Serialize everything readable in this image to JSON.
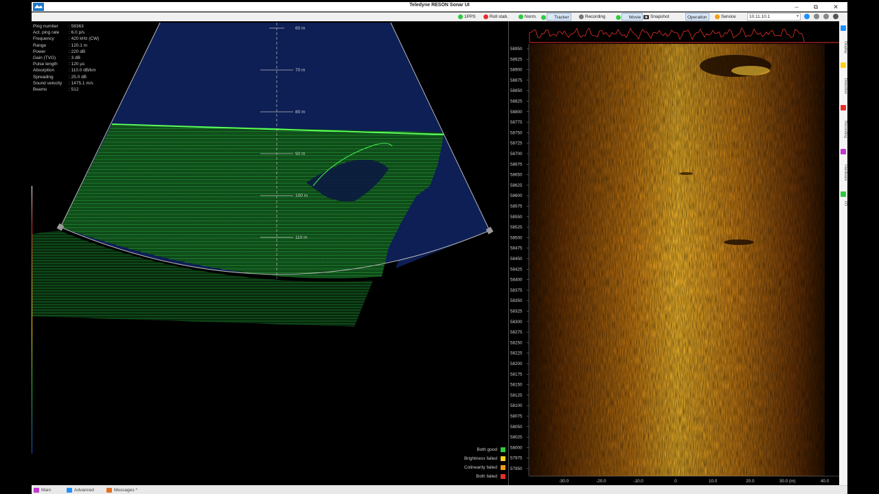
{
  "window": {
    "title": "Teledyne RESON Sonar UI",
    "colors": {
      "accent": "#1e90ff",
      "ok": "#2ecc40",
      "warn": "#ffd21f",
      "err": "#e8302a"
    }
  },
  "toolbar": {
    "items": [
      {
        "label": "1PPS",
        "status": "green"
      },
      {
        "label": "Roll stab.",
        "status": "red"
      },
      {
        "label": "Norm.",
        "status": "green"
      },
      {
        "label": "Tracker",
        "status": "green",
        "active": true
      },
      {
        "label": "Recording",
        "status": "gray"
      },
      {
        "label": "Movie",
        "status": "green",
        "active": true
      },
      {
        "label": "Snapshot",
        "status": "camera"
      },
      {
        "label": "Operation",
        "status": "none",
        "active": true
      },
      {
        "label": "Service",
        "status": "orange"
      }
    ],
    "ip_address": "10.11.10.1"
  },
  "sonar_info": {
    "rows": [
      {
        "key": "Ping number",
        "value": ": 58363"
      },
      {
        "key": "Act. ping rate",
        "value": ": 6.0 p/s"
      },
      {
        "key": "Frequency",
        "value": ": 420 kHz (CW)"
      },
      {
        "key": "Range",
        "value": ": 120.1 m"
      },
      {
        "key": "Power",
        "value": ": 220 dB"
      },
      {
        "key": "Gain (TVG)",
        "value": ": 3 dB"
      },
      {
        "key": "Pulse length",
        "value": ": 120 µs"
      },
      {
        "key": "Absorption",
        "value": ": 110.0 dB/km"
      },
      {
        "key": "Spreading",
        "value": ": 25.0 dB"
      },
      {
        "key": "Sound velocity",
        "value": ": 1475.1 m/s"
      },
      {
        "key": "Beams",
        "value": ": 512"
      }
    ]
  },
  "range_labels": [
    "60 m",
    "70 m",
    "80 m",
    "90 m",
    "100 m",
    "110 m"
  ],
  "legend": [
    {
      "label": "Both good",
      "color": "#2ecc40"
    },
    {
      "label": "Brightness failed",
      "color": "#ffd21f"
    },
    {
      "label": "Colinearity failed",
      "color": "#f39c12"
    },
    {
      "label": "Both failed",
      "color": "#e8302a"
    }
  ],
  "waterfall": {
    "y_labels": [
      "58950",
      "58925",
      "58900",
      "58875",
      "58850",
      "58825",
      "58800",
      "58775",
      "58750",
      "58725",
      "58700",
      "58675",
      "58650",
      "58625",
      "58600",
      "58575",
      "58550",
      "58525",
      "58500",
      "58475",
      "58450",
      "58425",
      "58400",
      "58375",
      "58350",
      "58325",
      "58300",
      "58275",
      "58250",
      "58225",
      "58200",
      "58175",
      "58150",
      "58125",
      "58100",
      "58075",
      "58050",
      "58025",
      "58000",
      "57975",
      "57950"
    ],
    "x_labels": [
      "-30.0",
      "-20.0",
      "-10.0",
      "0",
      "10.0",
      "20.0",
      "30.0 (m)",
      "40.0"
    ]
  },
  "side_tabs": [
    {
      "label": "Display",
      "color": "#1e90ff"
    },
    {
      "label": "Detection",
      "color": "#ffd21f"
    },
    {
      "label": "Recording",
      "color": "#e8302a"
    },
    {
      "label": "Hardware",
      "color": "#c03ad0"
    },
    {
      "label": "I/O",
      "color": "#2ecc40"
    }
  ],
  "statusbar": {
    "items": [
      {
        "label": "Main",
        "color": "#c03ad0"
      },
      {
        "label": "Advanced",
        "color": "#1e90ff"
      },
      {
        "label": "Messages *",
        "color": "#e07020"
      }
    ]
  }
}
